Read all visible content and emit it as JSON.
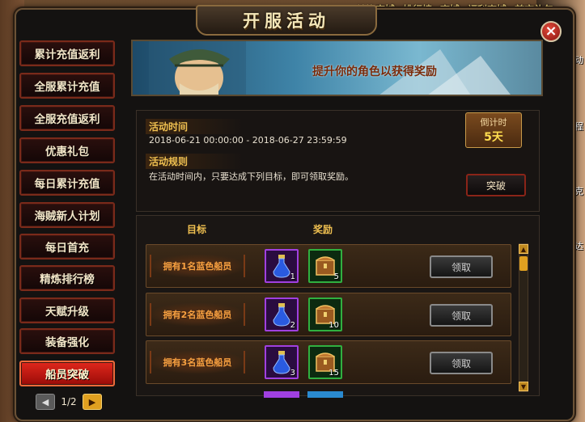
{
  "background": {
    "top_nav": [
      "兑换商城",
      "排行榜",
      "商城",
      "福利商城",
      "首充礼包"
    ],
    "right_labels": [
      "活动",
      "下列线程",
      "霍克",
      "达"
    ]
  },
  "window": {
    "title": "开服活动",
    "close_icon": "×"
  },
  "menu": {
    "items": [
      {
        "label": "累计充值返利",
        "active": false
      },
      {
        "label": "全服累计充值",
        "active": false
      },
      {
        "label": "全服充值返利",
        "active": false
      },
      {
        "label": "优惠礼包",
        "active": false
      },
      {
        "label": "每日累计充值",
        "active": false
      },
      {
        "label": "海贼新人计划",
        "active": false
      },
      {
        "label": "每日首充",
        "active": false
      },
      {
        "label": "精炼排行榜",
        "active": false
      },
      {
        "label": "天赋升级",
        "active": false
      },
      {
        "label": "装备强化",
        "active": false
      },
      {
        "label": "船员突破",
        "active": true
      }
    ],
    "pager": {
      "text": "1/2",
      "prev": "◀",
      "next": "▶"
    }
  },
  "banner": {
    "text": "提升你的角色以获得奖励"
  },
  "info": {
    "time_heading": "活动时间",
    "time_value": "2018-06-21 00:00:00 - 2018-06-27 23:59:59",
    "rules_heading": "活动规则",
    "rules_value": "在活动时间内，只要达成下列目标，即可领取奖励。",
    "countdown_label": "倒计时",
    "countdown_value": "5天",
    "break_button": "突破"
  },
  "list": {
    "col_target": "目标",
    "col_reward": "奖励",
    "rows": [
      {
        "target": "拥有1名蓝色船员",
        "potion_count": "1",
        "chest_count": "5",
        "claim": "领取"
      },
      {
        "target": "拥有2名蓝色船员",
        "potion_count": "2",
        "chest_count": "10",
        "claim": "领取"
      },
      {
        "target": "拥有3名蓝色船员",
        "potion_count": "3",
        "chest_count": "15",
        "claim": "领取"
      }
    ],
    "scroll_up": "▲",
    "scroll_down": "▼"
  },
  "colors": {
    "accent_gold": "#f0c050",
    "active_red": "#d01c12",
    "label_orange": "#f7a040"
  },
  "icons": {
    "potion": "blue-potion-icon",
    "chest": "treasure-chest-icon",
    "close": "close-icon"
  }
}
